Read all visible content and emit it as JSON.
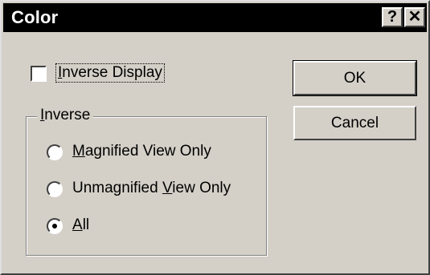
{
  "dialog": {
    "title": "Color",
    "help_button": "?",
    "close_button": "✕"
  },
  "inverse_display": {
    "label_underlined": "I",
    "label_rest": "nverse Display",
    "checked": false
  },
  "inverse_group": {
    "legend_underlined": "I",
    "legend_rest": "nverse",
    "options": [
      {
        "pre": "",
        "underlined": "M",
        "post": "agnified View Only",
        "selected": false
      },
      {
        "pre": "Unmagnified ",
        "underlined": "V",
        "post": "iew Only",
        "selected": false
      },
      {
        "pre": "",
        "underlined": "A",
        "post": "ll",
        "selected": true
      }
    ]
  },
  "buttons": {
    "ok": "OK",
    "cancel": "Cancel"
  }
}
